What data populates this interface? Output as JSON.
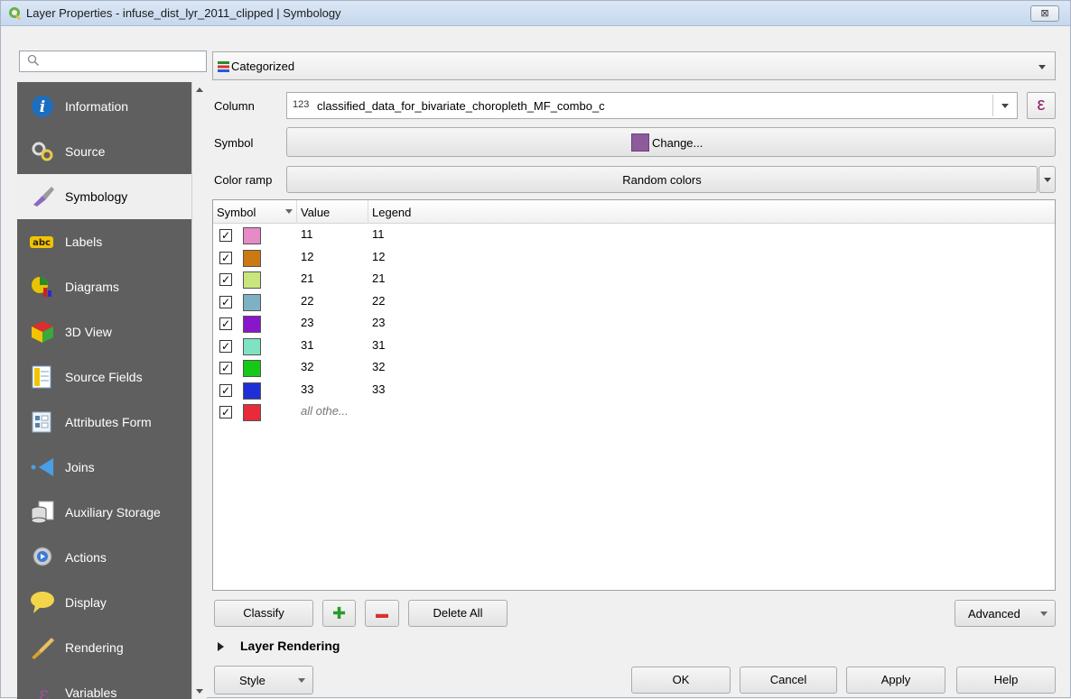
{
  "window": {
    "title": "Layer Properties - infuse_dist_lyr_2011_clipped | Symbology",
    "close_glyph": "⊠"
  },
  "search": {
    "placeholder": ""
  },
  "sidebar": {
    "items": [
      {
        "label": "Information",
        "icon": "information-icon"
      },
      {
        "label": "Source",
        "icon": "source-icon"
      },
      {
        "label": "Symbology",
        "icon": "symbology-icon",
        "active": true
      },
      {
        "label": "Labels",
        "icon": "labels-icon"
      },
      {
        "label": "Diagrams",
        "icon": "diagrams-icon"
      },
      {
        "label": "3D View",
        "icon": "3d-view-icon"
      },
      {
        "label": "Source Fields",
        "icon": "source-fields-icon"
      },
      {
        "label": "Attributes Form",
        "icon": "attributes-form-icon"
      },
      {
        "label": "Joins",
        "icon": "joins-icon"
      },
      {
        "label": "Auxiliary Storage",
        "icon": "auxiliary-storage-icon"
      },
      {
        "label": "Actions",
        "icon": "actions-icon"
      },
      {
        "label": "Display",
        "icon": "display-icon"
      },
      {
        "label": "Rendering",
        "icon": "rendering-icon"
      },
      {
        "label": "Variables",
        "icon": "variables-icon"
      }
    ]
  },
  "renderer": {
    "selected": "Categorized"
  },
  "form": {
    "column_label": "Column",
    "column_type": "123",
    "column_value": "classified_data_for_bivariate_choropleth_MF_combo_c",
    "expression_glyph": "ε",
    "symbol_label": "Symbol",
    "symbol_button": "Change...",
    "symbol_color": "#8d5a9c",
    "color_ramp_label": "Color ramp",
    "color_ramp_value": "Random colors"
  },
  "table": {
    "headers": {
      "symbol": "Symbol",
      "value": "Value",
      "legend": "Legend"
    },
    "rows": [
      {
        "checked": "✓",
        "color": "#e68ac8",
        "value": "11",
        "legend": "11"
      },
      {
        "checked": "✓",
        "color": "#c97a12",
        "value": "12",
        "legend": "12"
      },
      {
        "checked": "✓",
        "color": "#c9e67d",
        "value": "21",
        "legend": "21"
      },
      {
        "checked": "✓",
        "color": "#7fb1c6",
        "value": "22",
        "legend": "22"
      },
      {
        "checked": "✓",
        "color": "#8a16cc",
        "value": "23",
        "legend": "23"
      },
      {
        "checked": "✓",
        "color": "#7ee3c2",
        "value": "31",
        "legend": "31"
      },
      {
        "checked": "✓",
        "color": "#17c917",
        "value": "32",
        "legend": "32"
      },
      {
        "checked": "✓",
        "color": "#1f2fd6",
        "value": "33",
        "legend": "33"
      },
      {
        "checked": "✓",
        "color": "#e82a3a",
        "value": "all othe...",
        "legend": "",
        "italic": true
      }
    ]
  },
  "buttons": {
    "classify": "Classify",
    "add_glyph": "✚",
    "delete_glyph": "▬",
    "delete_all": "Delete All",
    "advanced": "Advanced",
    "layer_rendering": "Layer Rendering",
    "style": "Style",
    "ok": "OK",
    "cancel": "Cancel",
    "apply": "Apply",
    "help": "Help"
  }
}
